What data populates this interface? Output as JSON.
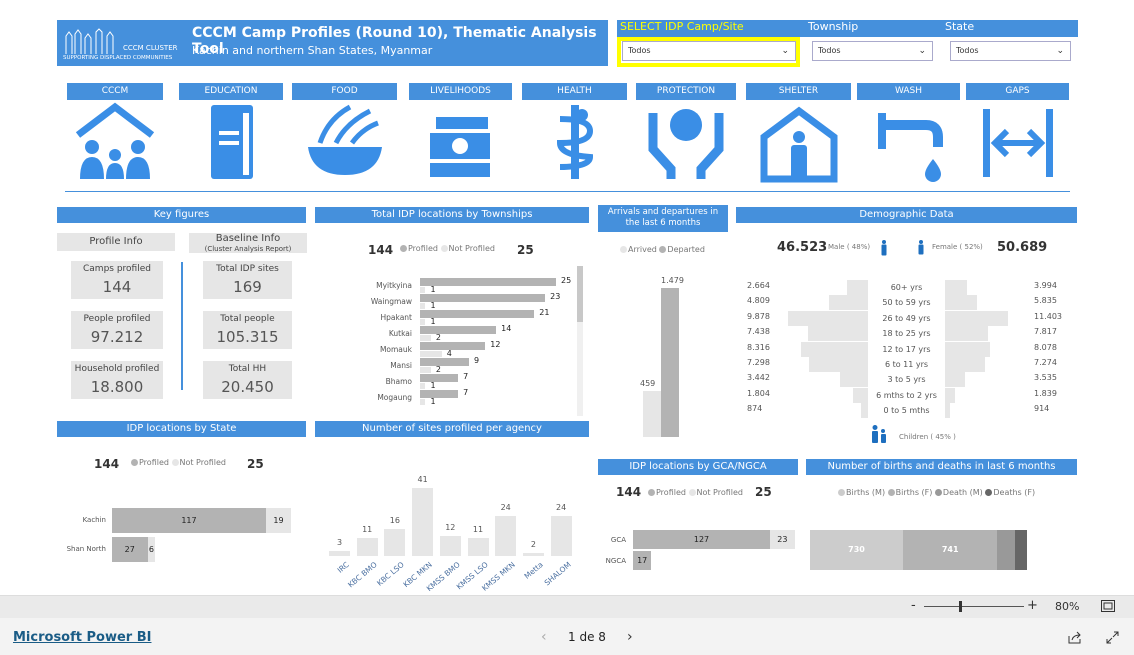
{
  "header": {
    "logo_text": "CCCM CLUSTER",
    "logo_tagline": "SUPPORTING DISPLACED COMMUNITIES",
    "title": "CCCM Camp Profiles (Round 10), Thematic Analysis Tool",
    "subtitle": "Kachin and northern Shan States, Myanmar"
  },
  "filters": [
    {
      "label": "SELECT IDP Camp/Site",
      "value": "Todos"
    },
    {
      "label": "Township",
      "value": "Todos"
    },
    {
      "label": "State",
      "value": "Todos"
    }
  ],
  "colors": {
    "accent": "#4590dc",
    "highlight": "#ffff00",
    "bar_dark": "#b3b3b3",
    "bar_light": "#e6e6e6",
    "icon": "#3a8ee6"
  },
  "tabs": [
    {
      "label": "CCCM",
      "icon": "family-house-icon"
    },
    {
      "label": "EDUCATION",
      "icon": "book-icon"
    },
    {
      "label": "FOOD",
      "icon": "food-bowl-icon"
    },
    {
      "label": "LIVELIHOODS",
      "icon": "money-icon"
    },
    {
      "label": "HEALTH",
      "icon": "caduceus-icon"
    },
    {
      "label": "PROTECTION",
      "icon": "protection-hands-icon"
    },
    {
      "label": "SHELTER",
      "icon": "shelter-icon"
    },
    {
      "label": "WASH",
      "icon": "tap-icon"
    },
    {
      "label": "GAPS",
      "icon": "gap-arrows-icon"
    }
  ],
  "key_figures": {
    "title": "Key figures",
    "profile_title": "Profile Info",
    "baseline_title": "Baseline Info",
    "baseline_sub": "(Cluster Analysis Report)",
    "profile": [
      {
        "label": "Camps profiled",
        "value": "144"
      },
      {
        "label": "People profiled",
        "value": "97.212"
      },
      {
        "label": "Household profiled",
        "value": "18.800"
      }
    ],
    "baseline": [
      {
        "label": "Total IDP sites",
        "value": "169"
      },
      {
        "label": "Total people",
        "value": "105.315"
      },
      {
        "label": "Total HH",
        "value": "20.450"
      }
    ]
  },
  "legend": {
    "profiled": "Profiled",
    "not_profiled": "Not Profiled",
    "profiled_total": "144",
    "not_profiled_total": "25"
  },
  "townships": {
    "title": "Total IDP locations by Townships",
    "chart_data": {
      "type": "bar",
      "orientation": "horizontal",
      "categories": [
        "Myitkyina",
        "Waingmaw",
        "Hpakant",
        "Kutkai",
        "Momauk",
        "Mansi",
        "Bhamo",
        "Mogaung"
      ],
      "series": [
        {
          "name": "Profiled",
          "values": [
            25,
            23,
            21,
            14,
            12,
            9,
            7,
            7
          ]
        },
        {
          "name": "Not Profiled",
          "values": [
            1,
            1,
            1,
            2,
            4,
            2,
            1,
            1
          ]
        }
      ]
    }
  },
  "arrivals": {
    "title": "Arrivals and departures in the last 6 months",
    "chart_data": {
      "type": "bar",
      "categories": [
        "Arrived",
        "Departed"
      ],
      "values": [
        459,
        1479
      ],
      "labels": [
        "459",
        "1.479"
      ]
    }
  },
  "demographic": {
    "title": "Demographic Data",
    "male_total": "46.523",
    "male_label": "Male",
    "male_pct": "( 48%)",
    "female_label": "Female",
    "female_pct": "( 52%)",
    "female_total": "50.689",
    "children_label": "Children",
    "children_pct": "( 45% )",
    "chart_data": {
      "type": "bar",
      "orientation": "pyramid",
      "categories": [
        "60+ yrs",
        "50 to 59 yrs",
        "26 to 49 yrs",
        "18 to 25 yrs",
        "12 to 17 yrs",
        "6 to 11 yrs",
        "3 to 5 yrs",
        "6 mths to 2 yrs",
        "0 to 5 mths"
      ],
      "male": [
        2664,
        4809,
        9878,
        7438,
        8316,
        7298,
        3442,
        1804,
        874
      ],
      "male_labels": [
        "2.664",
        "4.809",
        "9.878",
        "7.438",
        "8.316",
        "7.298",
        "3.442",
        "1.804",
        "874"
      ],
      "female": [
        3994,
        5835,
        11403,
        7817,
        8078,
        7274,
        3535,
        1839,
        914
      ],
      "female_labels": [
        "3.994",
        "5.835",
        "11.403",
        "7.817",
        "8.078",
        "7.274",
        "3.535",
        "1.839",
        "914"
      ]
    }
  },
  "by_state": {
    "title": "IDP locations by State",
    "chart_data": {
      "type": "bar",
      "orientation": "horizontal-stacked",
      "categories": [
        "Kachin",
        "Shan North"
      ],
      "series": [
        {
          "name": "Profiled",
          "values": [
            117,
            27
          ]
        },
        {
          "name": "Not Profiled",
          "values": [
            19,
            6
          ]
        }
      ]
    }
  },
  "agency": {
    "title": "Number of sites profiled per agency",
    "chart_data": {
      "type": "bar",
      "categories": [
        "IRC",
        "KBC BMO",
        "KBC LSO",
        "KBC MKN",
        "KMSS BMO",
        "KMSS LSO",
        "KMSS MKN",
        "Metta",
        "SHALOM"
      ],
      "values": [
        3,
        11,
        16,
        41,
        12,
        11,
        24,
        2,
        24
      ]
    }
  },
  "gca": {
    "title": "IDP locations by GCA/NGCA",
    "chart_data": {
      "type": "bar",
      "orientation": "horizontal-stacked",
      "categories": [
        "GCA",
        "NGCA"
      ],
      "series": [
        {
          "name": "Profiled",
          "values": [
            127,
            17
          ]
        },
        {
          "name": "Not Profiled",
          "values": [
            23,
            0
          ]
        }
      ]
    }
  },
  "births": {
    "title": "Number of births and deaths in last 6 months",
    "chart_data": {
      "type": "bar",
      "orientation": "horizontal-stacked",
      "series": [
        {
          "name": "Births (M)",
          "value": 730,
          "label": "730",
          "color": "#cccccc"
        },
        {
          "name": "Births (F)",
          "value": 741,
          "label": "741",
          "color": "#b3b3b3"
        },
        {
          "name": "Death (M)",
          "value": 140,
          "label": "",
          "color": "#999999"
        },
        {
          "name": "Deaths (F)",
          "value": 95,
          "label": "",
          "color": "#666666"
        }
      ]
    }
  },
  "toolbar": {
    "zoom_minus": "-",
    "zoom_plus": "+",
    "zoom_level": "80%",
    "zoom_fraction": 0.35
  },
  "footer": {
    "brand": "Microsoft Power BI",
    "page": "1 de 8"
  }
}
